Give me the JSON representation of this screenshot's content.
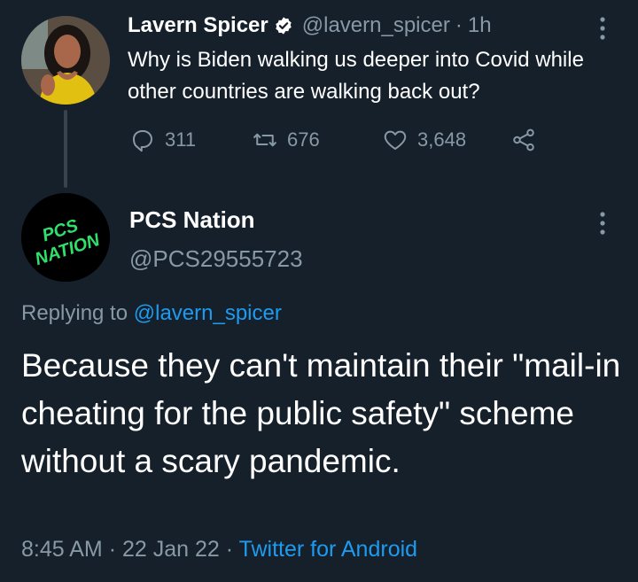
{
  "parent_tweet": {
    "name": "Lavern Spicer",
    "handle": "@lavern_spicer",
    "separator": "·",
    "time": "1h",
    "text": "Why is Biden walking us deeper into Covid while other countries are walking back out?",
    "replies": "311",
    "retweets": "676",
    "likes": "3,648"
  },
  "reply_tweet": {
    "name": "PCS Nation",
    "handle": "@PCS29555723",
    "avatar_text": "PCS NATION",
    "replying_prefix": "Replying to",
    "replying_handle": "@lavern_spicer",
    "text": "Because they can't maintain their \"mail-in cheating for the public safety\" scheme without a scary pandemic.",
    "timestamp": "8:45 AM",
    "sep1": "·",
    "date": "22 Jan 22",
    "sep2": "·",
    "source": "Twitter for Android"
  },
  "colors": {
    "background": "#15202b",
    "secondary_text": "#8899a6",
    "link": "#1d9bf0",
    "verified": "#ffffff",
    "avatar_text": "#2fe06a"
  },
  "icons": [
    "verified-badge-icon",
    "more-options-icon",
    "reply-icon",
    "retweet-icon",
    "like-icon",
    "share-icon"
  ]
}
